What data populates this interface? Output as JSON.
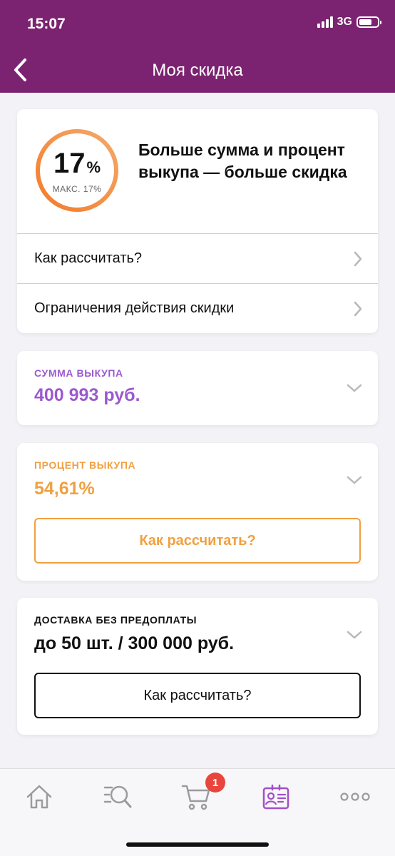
{
  "status": {
    "time": "15:07",
    "network": "3G",
    "battery_level": 0.72
  },
  "header": {
    "title": "Моя скидка"
  },
  "summary": {
    "discount_value": "17",
    "discount_unit": "%",
    "max_label": "МАКС. 17%",
    "headline": "Больше сумма и процент выкупа — больше скидка",
    "rows": [
      {
        "label": "Как рассчитать?"
      },
      {
        "label": "Ограничения действия скидки"
      }
    ],
    "progress_fraction": 1.0
  },
  "purchase_sum": {
    "label": "СУММА ВЫКУПА",
    "value": "400 993 руб."
  },
  "purchase_percent": {
    "label": "ПРОЦЕНТ ВЫКУПА",
    "value": "54,61%",
    "button_label": "Как рассчитать?"
  },
  "delivery": {
    "label": "ДОСТАВКА БЕЗ ПРЕДОПЛАТЫ",
    "value": "до 50 шт. / 300 000 руб.",
    "button_label": "Как рассчитать?"
  },
  "nav": {
    "items": [
      {
        "icon": "home-icon"
      },
      {
        "icon": "catalog-search-icon"
      },
      {
        "icon": "cart-icon"
      },
      {
        "icon": "profile-card-icon"
      },
      {
        "icon": "more-icon"
      }
    ],
    "cart_badge": "1"
  },
  "colors": {
    "header_bg": "#7b2370",
    "sum_accent": "#9b59d0",
    "percent_accent": "#f0a040",
    "ring_start": "#f47b2a",
    "ring_end": "#f4a96a",
    "nav_active": "#a24fc8",
    "badge": "#e8453c"
  }
}
